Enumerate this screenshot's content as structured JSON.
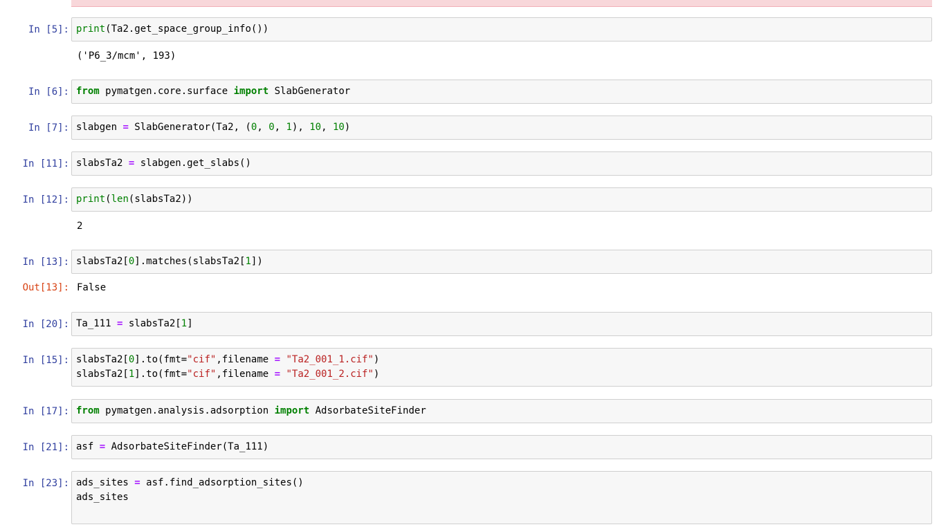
{
  "cells": [
    {
      "id": "c5",
      "prompt": "In [5]:",
      "lines": [
        [
          [
            "bi",
            "print"
          ],
          [
            "t",
            "(Ta2.get_space_group_info())"
          ]
        ]
      ],
      "output": "('P6_3/mcm', 193)"
    },
    {
      "id": "c6",
      "prompt": "In [6]:",
      "lines": [
        [
          [
            "kw",
            "from"
          ],
          [
            "t",
            " pymatgen.core.surface "
          ],
          [
            "kw",
            "import"
          ],
          [
            "t",
            " SlabGenerator"
          ]
        ]
      ]
    },
    {
      "id": "c7",
      "prompt": "In [7]:",
      "lines": [
        [
          [
            "t",
            "slabgen "
          ],
          [
            "op",
            "="
          ],
          [
            "t",
            " SlabGenerator(Ta2, ("
          ],
          [
            "num",
            "0"
          ],
          [
            "t",
            ", "
          ],
          [
            "num",
            "0"
          ],
          [
            "t",
            ", "
          ],
          [
            "num",
            "1"
          ],
          [
            "t",
            "), "
          ],
          [
            "num",
            "10"
          ],
          [
            "t",
            ", "
          ],
          [
            "num",
            "10"
          ],
          [
            "t",
            ")"
          ]
        ]
      ]
    },
    {
      "id": "c11",
      "prompt": "In [11]:",
      "lines": [
        [
          [
            "t",
            "slabsTa2 "
          ],
          [
            "op",
            "="
          ],
          [
            "t",
            " slabgen.get_slabs()"
          ]
        ]
      ]
    },
    {
      "id": "c12",
      "prompt": "In [12]:",
      "lines": [
        [
          [
            "bi",
            "print"
          ],
          [
            "t",
            "("
          ],
          [
            "bi",
            "len"
          ],
          [
            "t",
            "(slabsTa2))"
          ]
        ]
      ],
      "output": "2"
    },
    {
      "id": "c13",
      "prompt": "In [13]:",
      "lines": [
        [
          [
            "t",
            "slabsTa2["
          ],
          [
            "num",
            "0"
          ],
          [
            "t",
            "].matches(slabsTa2["
          ],
          [
            "num",
            "1"
          ],
          [
            "t",
            "])"
          ]
        ]
      ],
      "out_prompt": "Out[13]:",
      "output": "False"
    },
    {
      "id": "c20",
      "prompt": "In [20]:",
      "lines": [
        [
          [
            "t",
            "Ta_111 "
          ],
          [
            "op",
            "="
          ],
          [
            "t",
            " slabsTa2["
          ],
          [
            "num",
            "1"
          ],
          [
            "t",
            "]"
          ]
        ]
      ]
    },
    {
      "id": "c15",
      "prompt": "In [15]:",
      "lines": [
        [
          [
            "t",
            "slabsTa2["
          ],
          [
            "num",
            "0"
          ],
          [
            "t",
            "].to(fmt="
          ],
          [
            "str",
            "\"cif\""
          ],
          [
            "t",
            ",filename "
          ],
          [
            "op",
            "="
          ],
          [
            "t",
            " "
          ],
          [
            "str",
            "\"Ta2_001_1.cif\""
          ],
          [
            "t",
            ")"
          ]
        ],
        [
          [
            "t",
            "slabsTa2["
          ],
          [
            "num",
            "1"
          ],
          [
            "t",
            "].to(fmt="
          ],
          [
            "str",
            "\"cif\""
          ],
          [
            "t",
            ",filename "
          ],
          [
            "op",
            "="
          ],
          [
            "t",
            " "
          ],
          [
            "str",
            "\"Ta2_001_2.cif\""
          ],
          [
            "t",
            ")"
          ]
        ]
      ]
    },
    {
      "id": "c17",
      "prompt": "In [17]:",
      "lines": [
        [
          [
            "kw",
            "from"
          ],
          [
            "t",
            " pymatgen.analysis.adsorption "
          ],
          [
            "kw",
            "import"
          ],
          [
            "t",
            " AdsorbateSiteFinder"
          ]
        ]
      ]
    },
    {
      "id": "c21",
      "prompt": "In [21]:",
      "lines": [
        [
          [
            "t",
            "asf "
          ],
          [
            "op",
            "="
          ],
          [
            "t",
            " AdsorbateSiteFinder(Ta_111)"
          ]
        ]
      ]
    },
    {
      "id": "c23",
      "prompt": "In [23]:",
      "lines": [
        [
          [
            "t",
            "ads_sites "
          ],
          [
            "op",
            "="
          ],
          [
            "t",
            " asf.find_adsorption_sites()"
          ]
        ],
        [
          [
            "t",
            "ads_sites"
          ]
        ],
        [
          [
            "t",
            ""
          ]
        ]
      ]
    }
  ],
  "colors": {
    "prompt_in": "#303f9f",
    "prompt_out": "#d84315",
    "keyword": "#008000",
    "operator": "#aa22ff",
    "string": "#ba2121",
    "cell_bg": "#f7f7f7",
    "error_bg": "#f8d7da"
  }
}
